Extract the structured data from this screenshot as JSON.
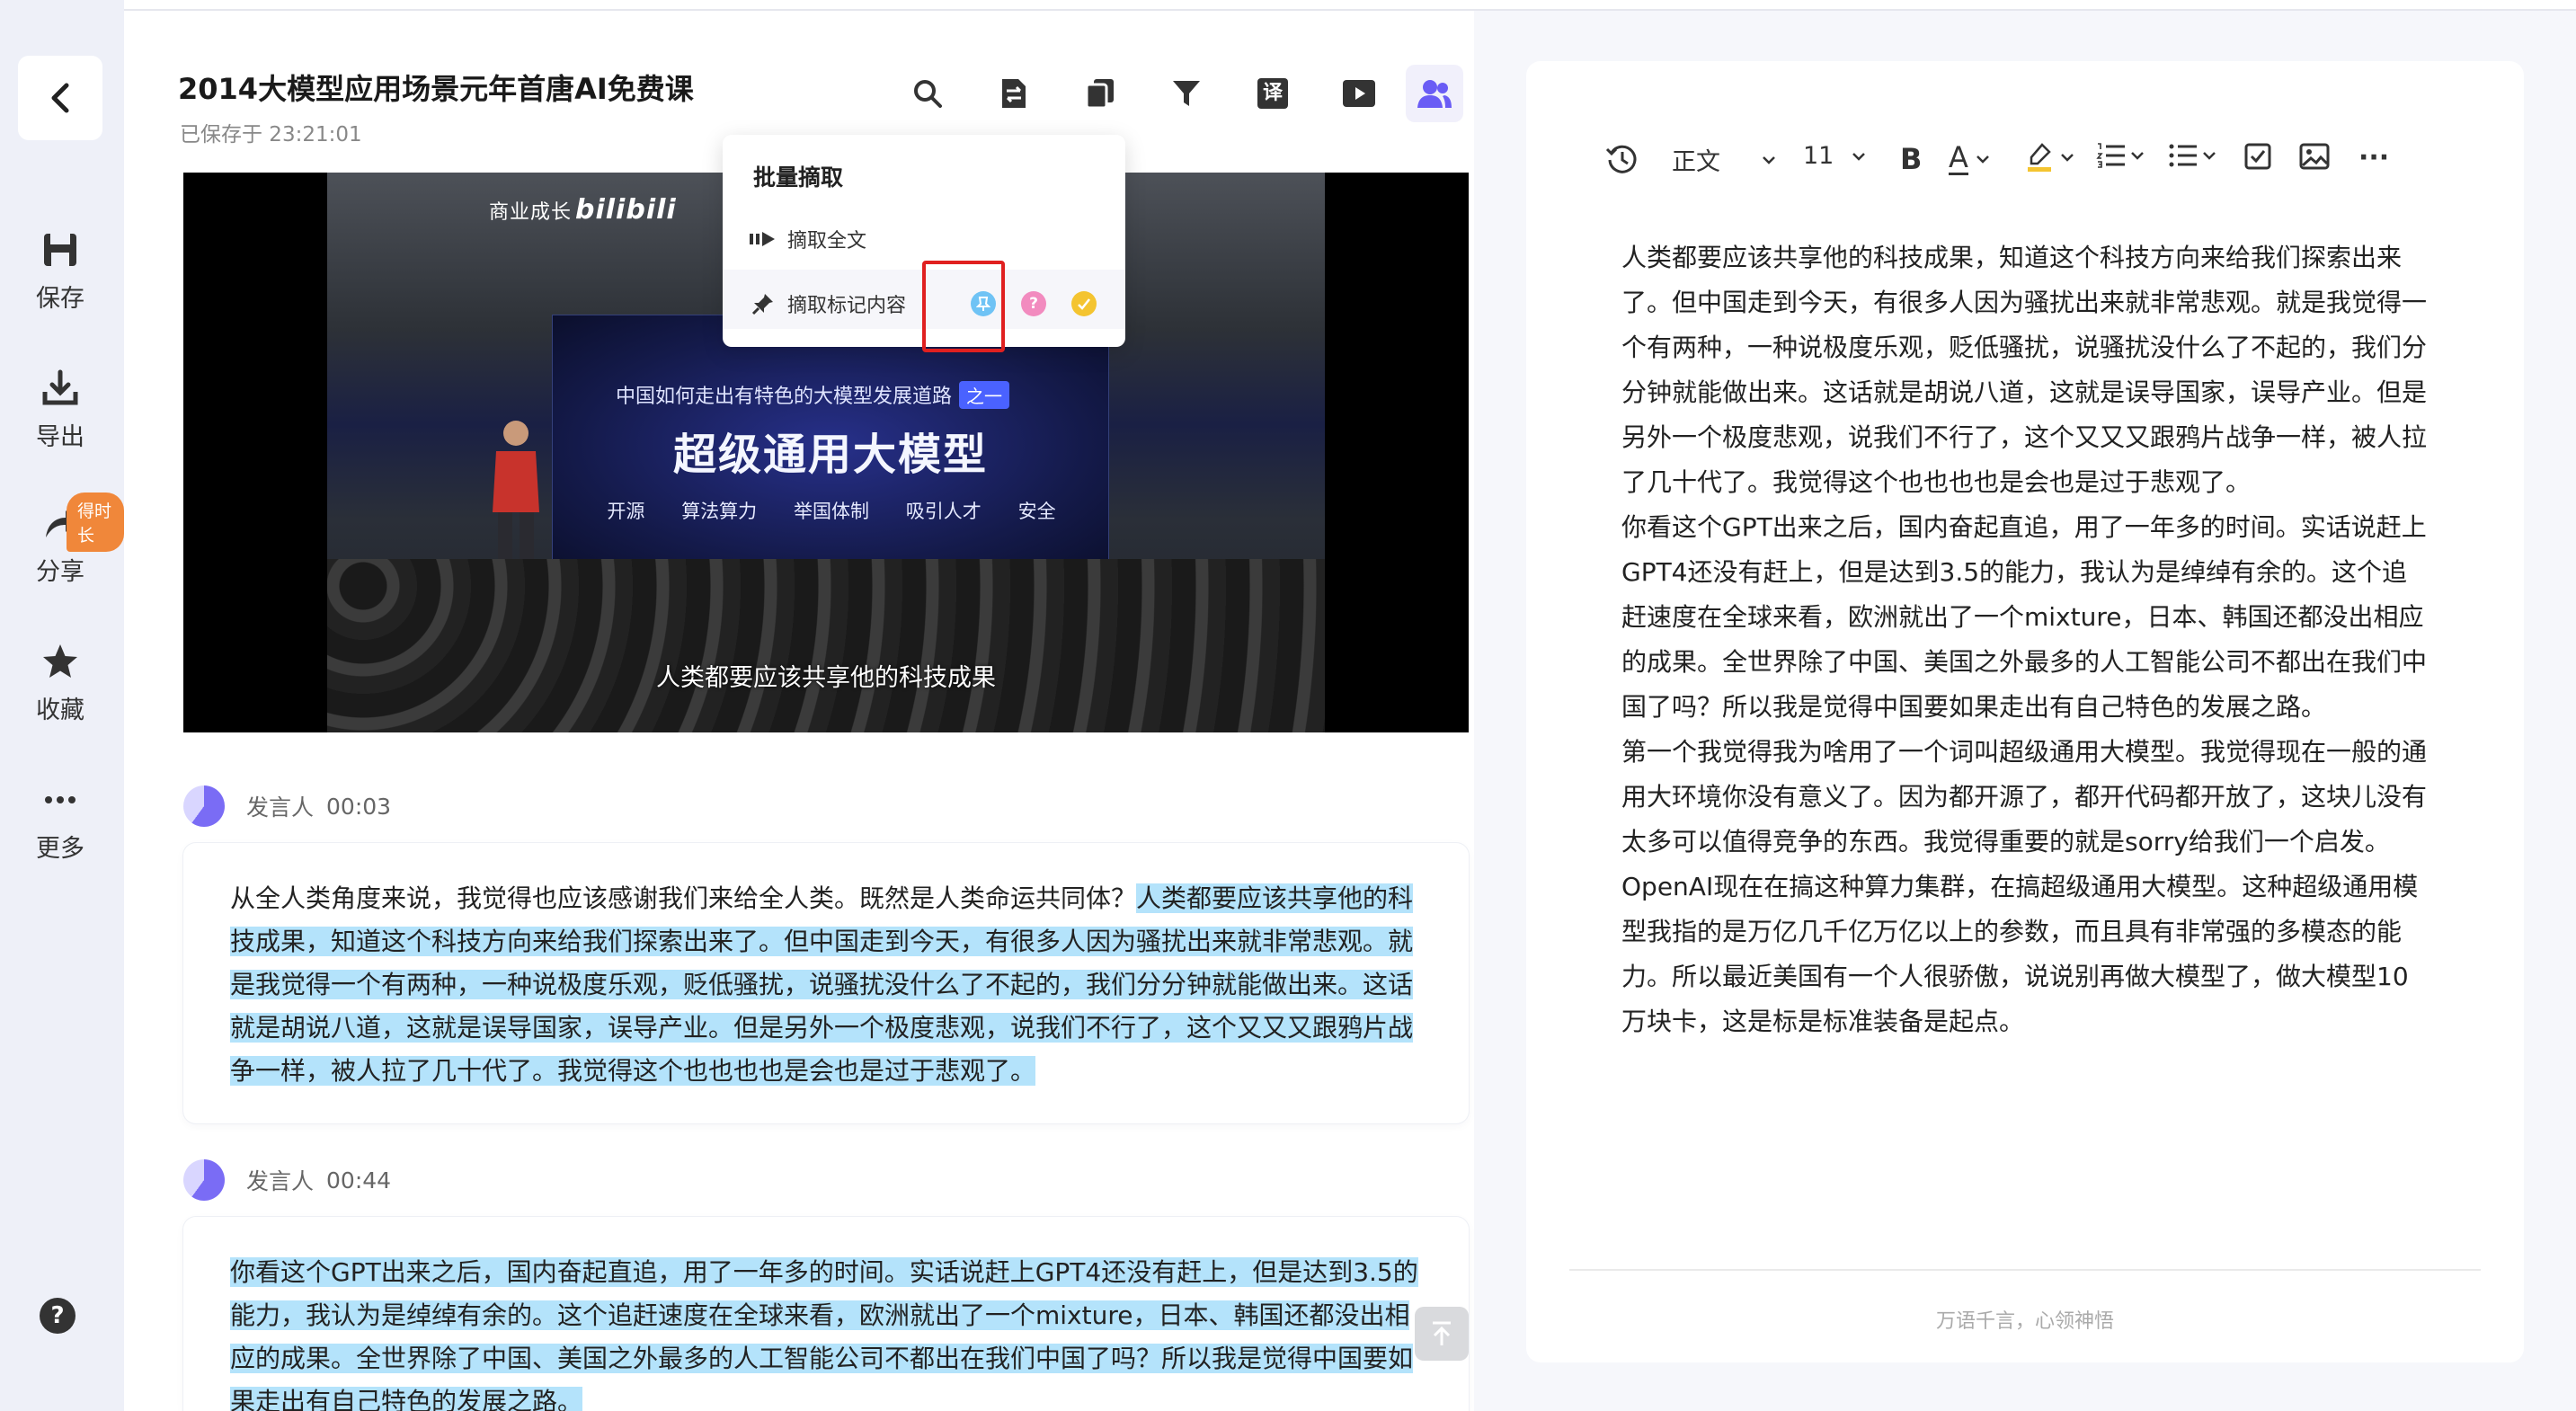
{
  "sidebar": {
    "items": [
      {
        "label": "保存",
        "icon": "save-icon"
      },
      {
        "label": "导出",
        "icon": "export-icon"
      },
      {
        "label": "分享",
        "icon": "share-icon"
      },
      {
        "label": "收藏",
        "icon": "star-icon"
      },
      {
        "label": "更多",
        "icon": "more-icon"
      }
    ],
    "share_badge": "得时长"
  },
  "header": {
    "title": "2014大模型应用场景元年首唐AI免费课",
    "saved_at": "已保存于 23:21:01"
  },
  "toolbar": [
    "search-icon",
    "swap-icon",
    "copy-icon",
    "filter-icon",
    "translate-icon",
    "play-icon",
    "speakers-icon"
  ],
  "toolbar_translate_glyph": "译",
  "popup": {
    "heading": "批量摘取",
    "extract_all": "摘取全文",
    "extract_marked": "摘取标记内容",
    "mark_colors": [
      "#6fc3f5",
      "#f28bbf",
      "#f4c430"
    ]
  },
  "video": {
    "channel": "商业成长",
    "brand": "bilibili",
    "slide_subtitle": "中国如何走出有特色的大模型发展道路",
    "slide_tag": "之一",
    "slide_title": "超级通用大模型",
    "slide_keywords": [
      "开源",
      "算法算力",
      "举国体制",
      "吸引人才",
      "安全"
    ],
    "subtitle": "人类都要应该共享他的科技成果"
  },
  "transcript": [
    {
      "speaker": "发言人",
      "time": "00:03",
      "plain": "从全人类角度来说，我觉得也应该感谢我们来给全人类。既然是人类命运共同体？",
      "highlighted": "人类都要应该共享他的科技成果，知道这个科技方向来给我们探索出来了。但中国走到今天，有很多人因为骚扰出来就非常悲观。就是我觉得一个有两种，一种说极度乐观，贬低骚扰，说骚扰没什么了不起的，我们分分钟就能做出来。这话就是胡说八道，这就是误导国家，误导产业。但是另外一个极度悲观，说我们不行了，这个又又又跟鸦片战争一样，被人拉了几十代了。我觉得这个也也也也是会也是过于悲观了。"
    },
    {
      "speaker": "发言人",
      "time": "00:44",
      "plain": "",
      "highlighted": "你看这个GPT出来之后，国内奋起直追，用了一年多的时间。实话说赶上GPT4还没有赶上，但是达到3.5的能力，我认为是绰绰有余的。这个追赶速度在全球来看，欧洲就出了一个mixture，日本、韩国还都没出相应的成果。全世界除了中国、美国之外最多的人工智能公司不都出在我们中国了吗？所以我是觉得中国要如果走出有自己特色的发展之路。"
    }
  ],
  "editor": {
    "style_label": "正文",
    "font_size": "11",
    "bold": "B",
    "text_color": "A",
    "more": "···",
    "paragraphs": [
      "人类都要应该共享他的科技成果，知道这个科技方向来给我们探索出来了。但中国走到今天，有很多人因为骚扰出来就非常悲观。就是我觉得一个有两种，一种说极度乐观，贬低骚扰，说骚扰没什么了不起的，我们分分钟就能做出来。这话就是胡说八道，这就是误导国家，误导产业。但是另外一个极度悲观，说我们不行了，这个又又又跟鸦片战争一样，被人拉了几十代了。我觉得这个也也也也是会也是过于悲观了。",
      "你看这个GPT出来之后，国内奋起直追，用了一年多的时间。实话说赶上GPT4还没有赶上，但是达到3.5的能力，我认为是绰绰有余的。这个追赶速度在全球来看，欧洲就出了一个mixture，日本、韩国还都没出相应的成果。全世界除了中国、美国之外最多的人工智能公司不都出在我们中国了吗？所以我是觉得中国要如果走出有自己特色的发展之路。",
      "第一个我觉得我为啥用了一个词叫超级通用大模型。我觉得现在一般的通用大环境你没有意义了。因为都开源了，都开代码都开放了，这块儿没有太多可以值得竞争的东西。我觉得重要的就是sorry给我们一个启发。OpenAI现在在搞这种算力集群，在搞超级通用大模型。这种超级通用模型我指的是万亿几千亿万亿以上的参数，而且具有非常强的多模态的能力。所以最近美国有一个人很骄傲，说说别再做大模型了，做大模型10万块卡，这是标是标准装备是起点。"
    ],
    "footer": "万语千言，心领神悟"
  },
  "colors": {
    "accent": "#6a5cf5",
    "highlight": "#b4e3fb",
    "sidebar_bg": "#eef0f8"
  }
}
